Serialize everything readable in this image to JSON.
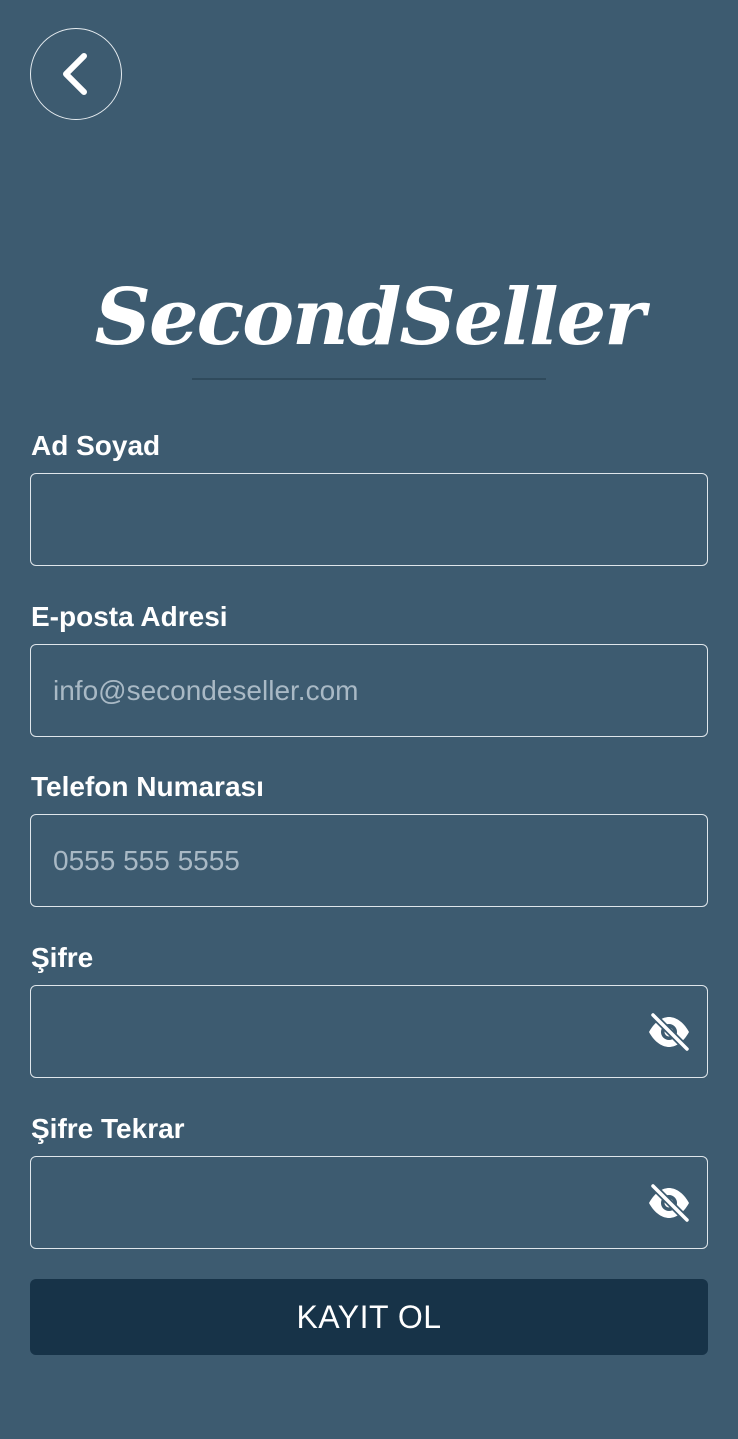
{
  "app": {
    "logo_text": "SecondSeller"
  },
  "icons": {
    "back": "chevron-left-icon",
    "visibility": "eye-off-icon"
  },
  "form": {
    "fields": [
      {
        "label": "Ad Soyad",
        "placeholder": "",
        "value": ""
      },
      {
        "label": "E-posta Adresi",
        "placeholder": "info@secondeseller.com",
        "value": ""
      },
      {
        "label": "Telefon Numarası",
        "placeholder": "0555 555 5555",
        "value": ""
      },
      {
        "label": "Şifre",
        "placeholder": "",
        "value": ""
      },
      {
        "label": "Şifre Tekrar",
        "placeholder": "",
        "value": ""
      }
    ],
    "submit_label": "KAYIT OL"
  },
  "colors": {
    "background": "#3d5b70",
    "button": "#173348",
    "border": "#dfe6eb",
    "placeholder": "#a9b9c5"
  }
}
